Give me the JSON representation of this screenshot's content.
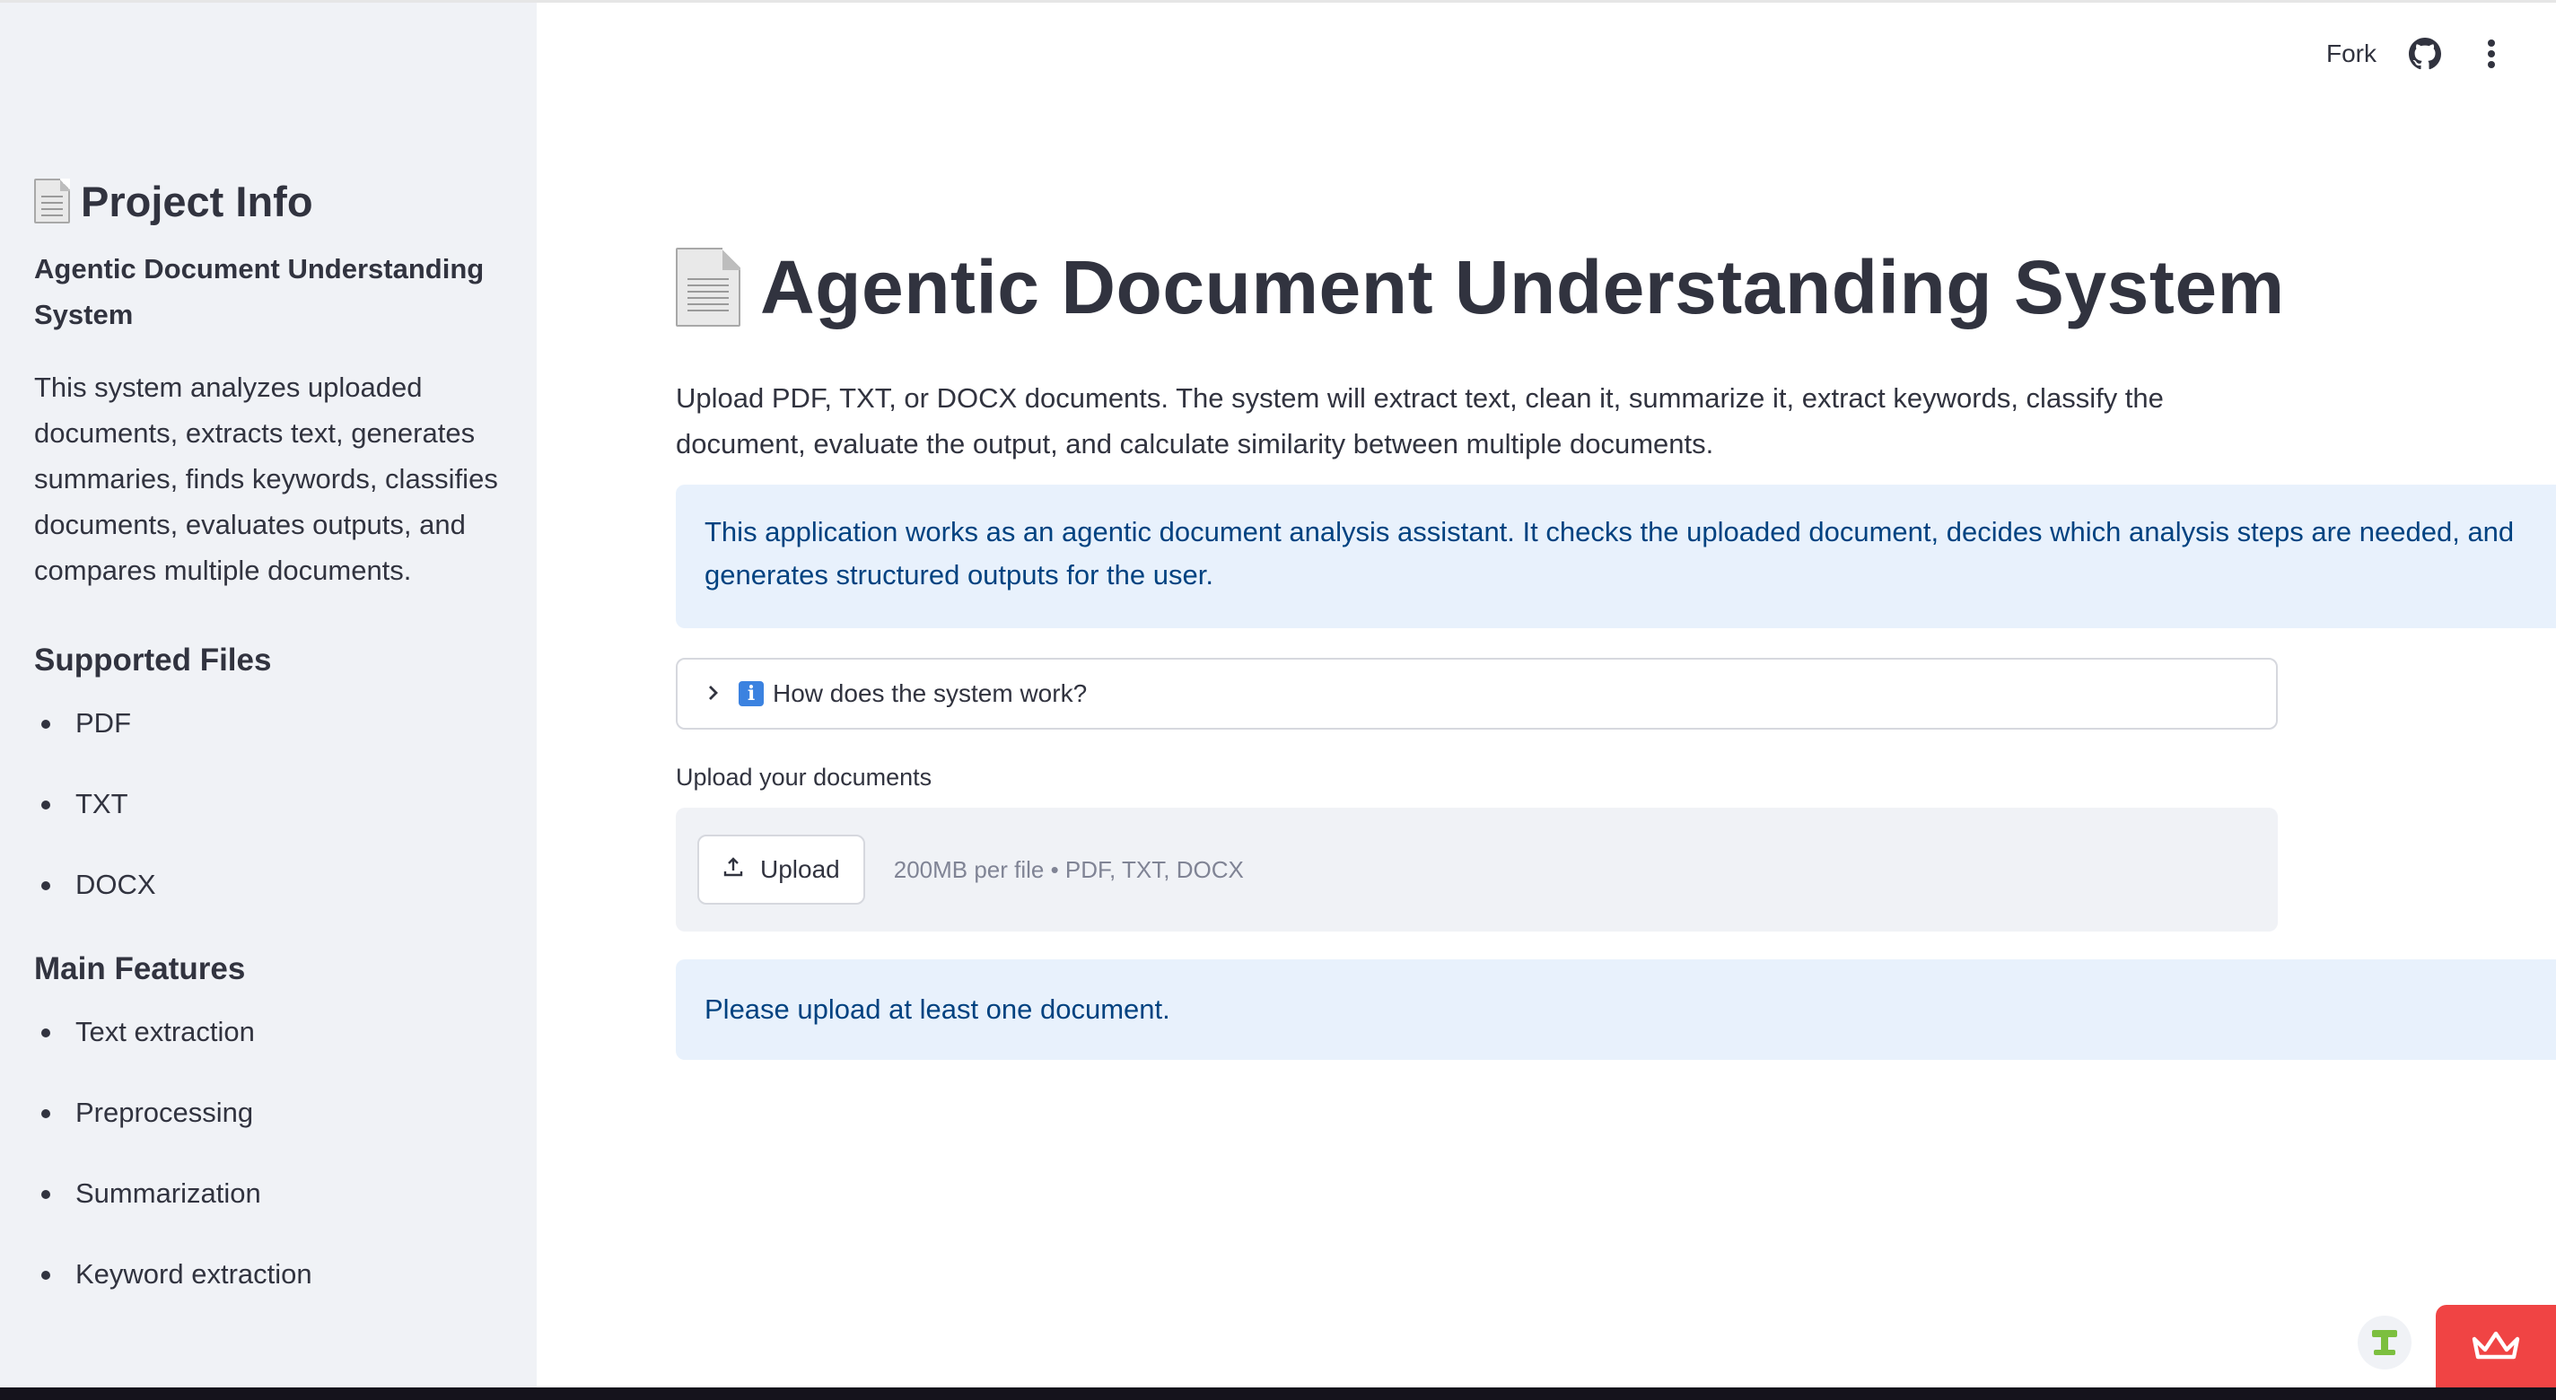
{
  "toolbar": {
    "fork_label": "Fork",
    "github_icon": "github-icon",
    "menu_icon": "kebab-menu-icon"
  },
  "sidebar": {
    "title": "Project Info",
    "subtitle": "Agentic Document Understanding System",
    "description": "This system analyzes uploaded documents, extracts text, generates summaries, finds keywords, classifies documents, evaluates outputs, and compares multiple documents.",
    "supported_heading": "Supported Files",
    "supported_files": [
      "PDF",
      "TXT",
      "DOCX"
    ],
    "features_heading": "Main Features",
    "features": [
      "Text extraction",
      "Preprocessing",
      "Summarization",
      "Keyword extraction"
    ]
  },
  "main": {
    "title": "Agentic Document Understanding System",
    "intro": "Upload PDF, TXT, or DOCX documents. The system will extract text, clean it, summarize it, extract keywords, classify the document, evaluate the output, and calculate similarity between multiple documents.",
    "info_alert": "This application works as an agentic document analysis assistant. It checks the uploaded document, decides which analysis steps are needed, and generates structured outputs for the user.",
    "expander_label": "How does the system work?",
    "upload_label": "Upload your documents",
    "upload_button": "Upload",
    "upload_hint": "200MB per file • PDF, TXT, DOCX",
    "status_alert": "Please upload at least one document."
  },
  "colors": {
    "accent_red": "#f04444",
    "info_bg": "#e8f1fc",
    "info_text": "#004280",
    "sidebar_bg": "#f0f2f6"
  }
}
